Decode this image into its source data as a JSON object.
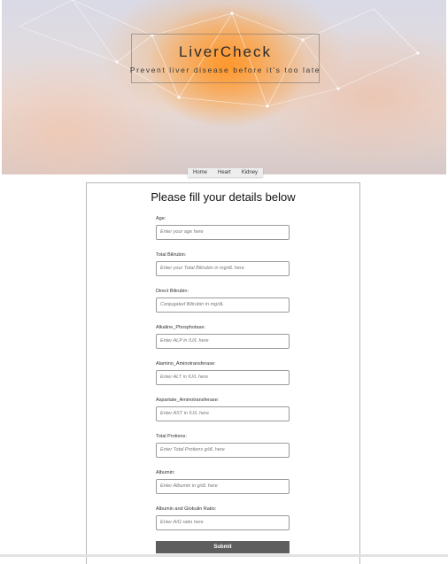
{
  "hero": {
    "title": "LiverCheck",
    "subtitle": "Prevent liver disease before it's too late"
  },
  "nav": {
    "items": [
      "Home",
      "Heart",
      "Kidney"
    ]
  },
  "form": {
    "heading": "Please fill your details below",
    "fields": [
      {
        "label": "Age:",
        "placeholder": "Enter your age here"
      },
      {
        "label": "Total Bilirubin:",
        "placeholder": "Enter your Total Bilirubin in mg/dL here"
      },
      {
        "label": "Direct Bilirubin:",
        "placeholder": "Conjugated Bilirubin in mg/dL"
      },
      {
        "label": "Alkaline_Phosphotase:",
        "placeholder": "Enter ALP in IU/L here"
      },
      {
        "label": "Alamino_Aminotransferase:",
        "placeholder": "Enter ALT in IU/L here"
      },
      {
        "label": "Aspartate_Aminotransferase:",
        "placeholder": "Enter AST in IU/L here"
      },
      {
        "label": "Total Protiens:",
        "placeholder": "Enter Total Protiens g/dL here"
      },
      {
        "label": "Albumin:",
        "placeholder": "Enter Albumin in g/dL here"
      },
      {
        "label": "Albumin and Globulin Ratio:",
        "placeholder": "Enter A/G ratio here"
      }
    ],
    "submit_label": "Submit"
  }
}
